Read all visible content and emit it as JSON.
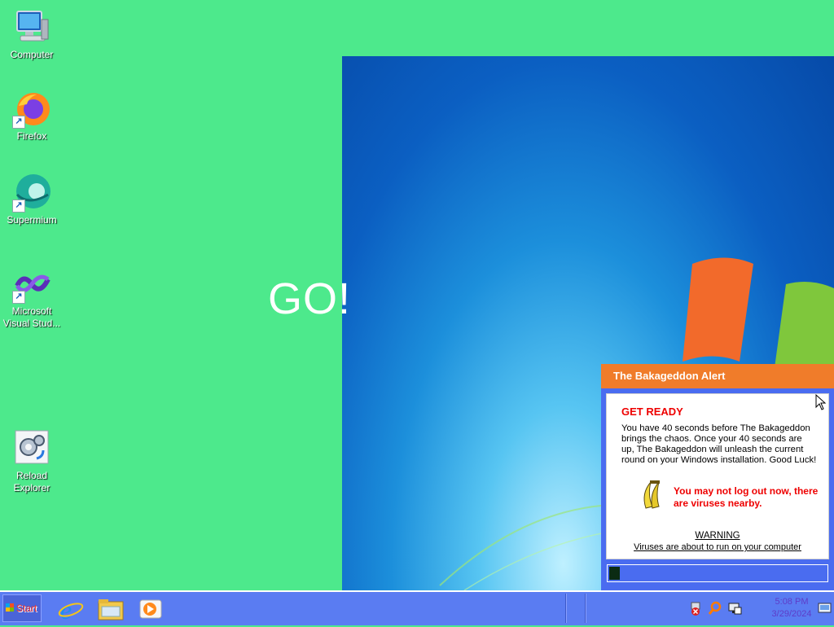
{
  "desktop": {
    "icons": [
      {
        "label": "Computer"
      },
      {
        "label": "Firefox"
      },
      {
        "label": "Supermium"
      },
      {
        "label": "Microsoft Visual Stud..."
      },
      {
        "label": "Reload Explorer"
      }
    ],
    "overlay_text": "GO!"
  },
  "alert": {
    "title": "The Bakageddon Alert",
    "heading": "GET READY",
    "body": "You have 40 seconds before The Bakageddon brings the chaos. Once your 40 seconds are up, The Bakageddon will unleash the current round on your Windows installation. Good Luck!",
    "notice": "You may not log out now, there are viruses nearby.",
    "warning_title": "WARNING",
    "warning_subtitle": "Viruses are about to run on your computer",
    "progress": 0.05
  },
  "taskbar": {
    "start_label": "Start",
    "pinned": [
      "internet-explorer",
      "file-explorer",
      "media-player"
    ],
    "tray": {
      "time": "5:08 PM",
      "date": "3/29/2024"
    }
  },
  "colors": {
    "desktop_bg": "#4de98c",
    "alert_title_bg": "#f07c2a",
    "alert_frame": "#4a6cf0",
    "taskbar": "#5a7cf2",
    "warning_red": "#e00000"
  }
}
